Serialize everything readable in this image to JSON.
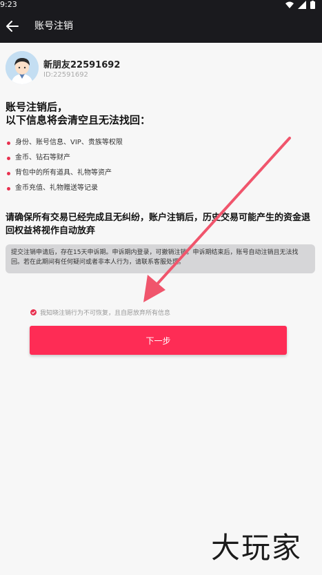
{
  "status_bar": {
    "time": "9:23"
  },
  "appbar": {
    "title": "账号注销"
  },
  "profile": {
    "name": "新朋友22591692",
    "id": "ID:22591692"
  },
  "heading": {
    "line1": "账号注销后，",
    "line2": "以下信息将会清空且无法找回："
  },
  "bullets": [
    "身份、账号信息、VIP、贵族等权限",
    "金币、钻石等财产",
    "背包中的所有道具、礼物等资产",
    "金币充值、礼物赠送等记录"
  ],
  "warning": "请确保所有交易已经完成且无纠纷，账户注销后，历史交易可能产生的资金退回权益将视作自动放弃",
  "notice": "提交注销申请后，存在15天申诉期。申诉期内登录，可撤销注销。申诉期结束后，账号自动注销且无法找回。若在此期间有任何疑问或者非本人行为，请联系客服处理。",
  "agreement": "我知晓注销行为不可恢复，且自愿放弃所有信息",
  "next_button": "下一步",
  "watermark": "大玩家",
  "colors": {
    "accent": "#fe2c55",
    "appbar": "#1a1a1e",
    "annotation_arrow": "#f0556c"
  }
}
